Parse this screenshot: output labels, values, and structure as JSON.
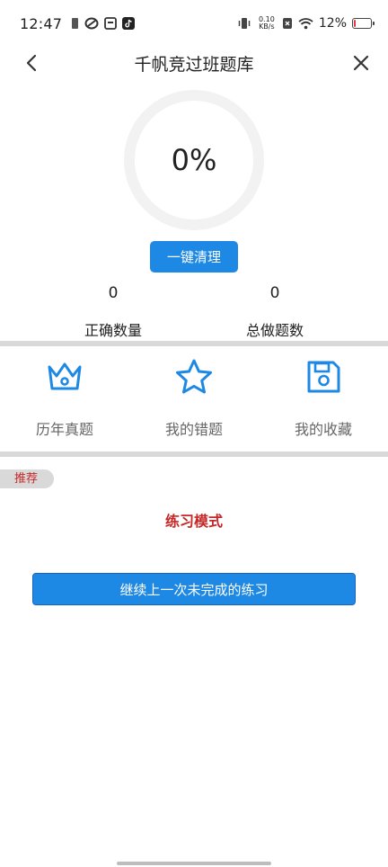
{
  "status_bar": {
    "time": "12:47",
    "net_speed_value": "0.10",
    "net_speed_unit": "KB/s",
    "battery_percent": "12%",
    "battery_level": 0.12,
    "battery_color": "#e53935"
  },
  "header": {
    "title": "千帆竞过班题库",
    "back_icon": "chevron-left-icon",
    "close_icon": "close-icon"
  },
  "progress": {
    "percent_label": "0%",
    "value": 0
  },
  "actions": {
    "clear_label": "一键清理"
  },
  "stats": [
    {
      "value": "0",
      "label": "正确数量"
    },
    {
      "value": "0",
      "label": "总做题数"
    }
  ],
  "entries": [
    {
      "label": "历年真题",
      "icon": "crown-icon"
    },
    {
      "label": "我的错题",
      "icon": "star-icon"
    },
    {
      "label": "我的收藏",
      "icon": "floppy-disk-icon"
    }
  ],
  "recommend": {
    "tag": "推荐",
    "mode_title": "练习模式",
    "continue_label": "继续上一次未完成的练习"
  },
  "colors": {
    "accent": "#1e88e5",
    "red": "#c62828",
    "divider": "#d9d9d9"
  }
}
